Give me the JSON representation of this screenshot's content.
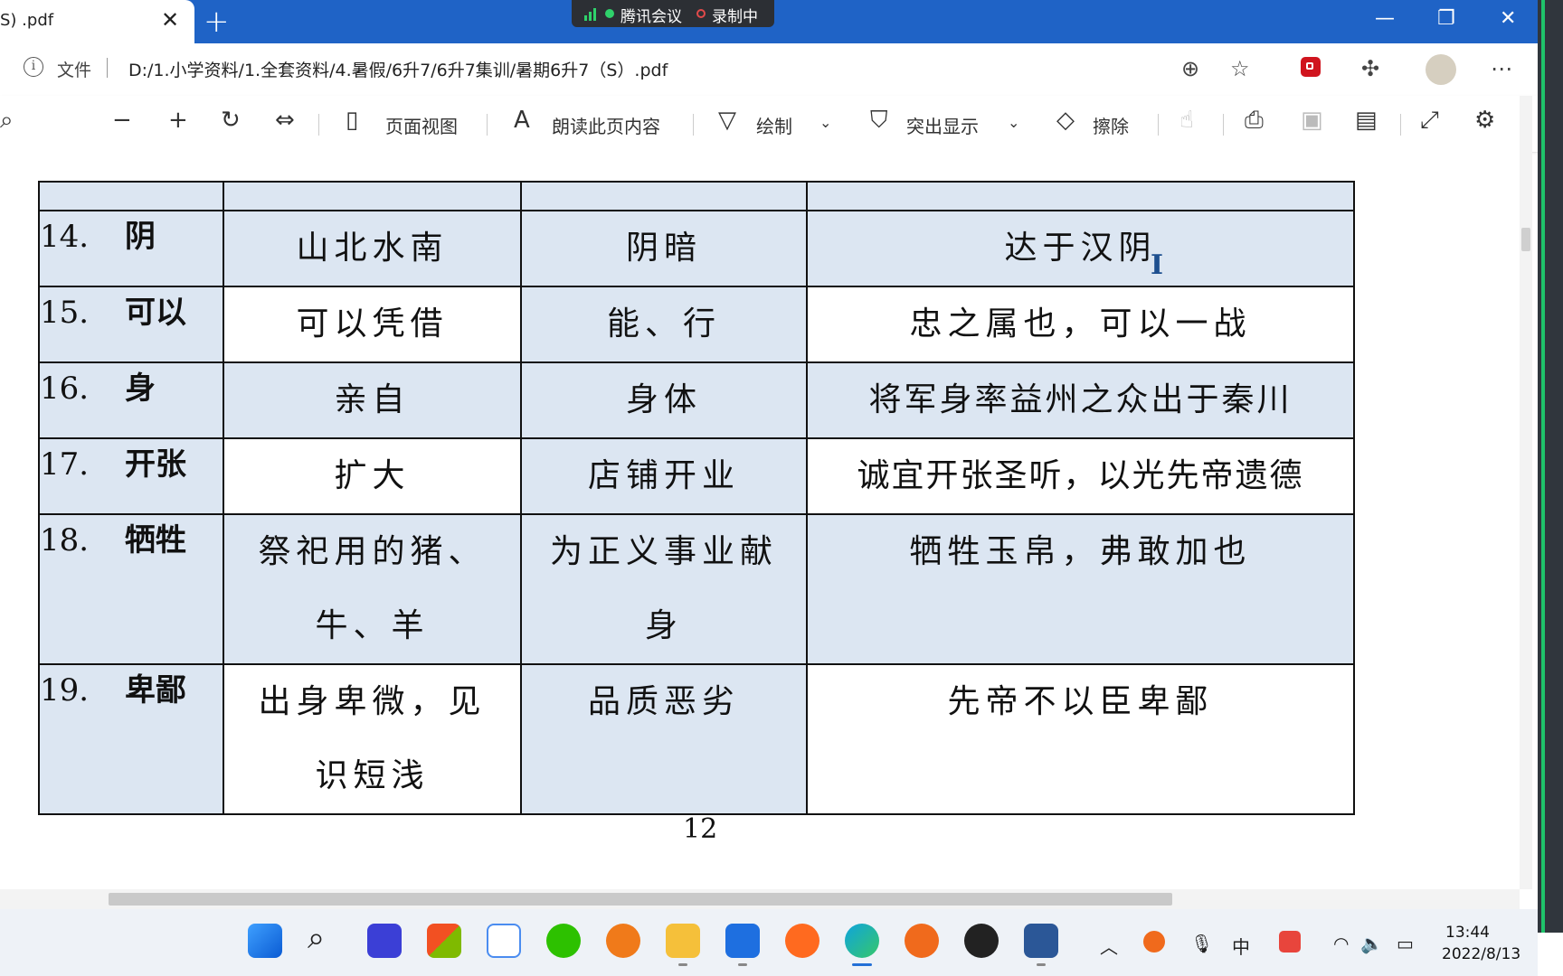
{
  "browser": {
    "tab_title": "S) .pdf",
    "meeting_app": "腾讯会议",
    "meeting_recording": "录制中",
    "file_label": "文件",
    "url": "D:/1.小学资料/1.全套资料/4.暑假/6升7/6升7集训/暑期6升7（S）.pdf"
  },
  "toolbar": {
    "page_view": "页面视图",
    "read_aloud": "朗读此页内容",
    "draw": "绘制",
    "highlight": "突出显示",
    "erase": "擦除"
  },
  "table": {
    "rows": [
      {
        "num": "14.",
        "word": "阴",
        "meaning1": "山北水南",
        "meaning2": "阴暗",
        "example": "达于汉阴"
      },
      {
        "num": "15.",
        "word": "可以",
        "meaning1": "可以凭借",
        "meaning2": "能、行",
        "example": "忠之属也，可以一战"
      },
      {
        "num": "16.",
        "word": "身",
        "meaning1": "亲自",
        "meaning2": "身体",
        "example": "将军身率益州之众出于秦川"
      },
      {
        "num": "17.",
        "word": "开张",
        "meaning1": "扩大",
        "meaning2": "店铺开业",
        "example": "诚宜开张圣听，以光先帝遗德"
      },
      {
        "num": "18.",
        "word": "牺牲",
        "meaning1a": "祭祀用的猪、",
        "meaning1b": "牛、羊",
        "meaning2a": "为正义事业献",
        "meaning2b": "身",
        "example": "牺牲玉帛，弗敢加也"
      },
      {
        "num": "19.",
        "word": "卑鄙",
        "meaning1a": "出身卑微，见",
        "meaning1b": "识短浅",
        "meaning2": "品质恶劣",
        "example": "先帝不以臣卑鄙"
      }
    ]
  },
  "page_number": "12",
  "taskbar": {
    "ime": "中",
    "time": "13:44",
    "date": "2022/8/13"
  },
  "colors": {
    "titlebar": "#1f63c6",
    "table_shade": "#dce6f2",
    "recording_green": "#1fc36a"
  }
}
